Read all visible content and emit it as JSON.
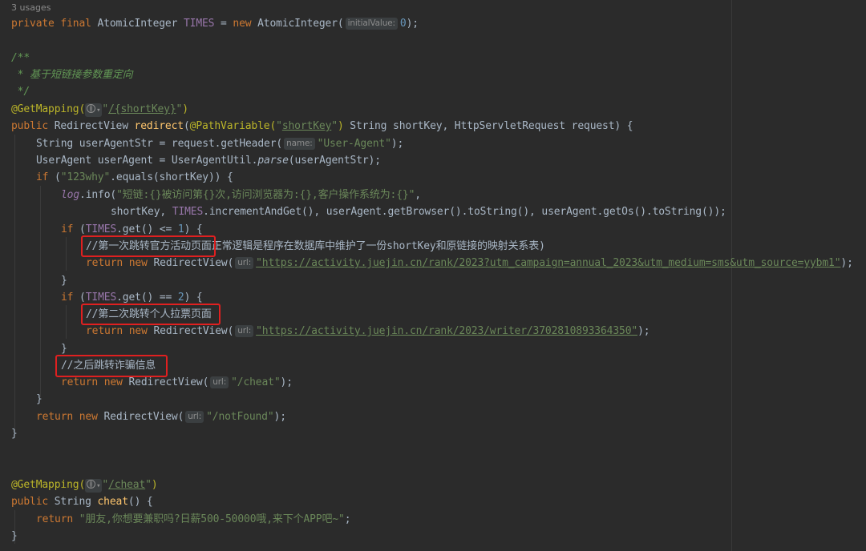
{
  "editor": {
    "usages": "3 usages",
    "colors": {
      "background": "#2b2b2b",
      "keyword": "#cc7832",
      "string": "#6a8759",
      "comment": "#629755",
      "annotation": "#bbb529",
      "field": "#9876aa",
      "method": "#ffc66d",
      "number": "#6897bb",
      "highlight_box": "#e02020"
    },
    "icons": {
      "mapping_hint": "web-globe-icon"
    },
    "hints": {
      "initial_value": "initialValue:",
      "name": "name:",
      "url": "url:"
    },
    "code": {
      "decl": {
        "kw": "private final ",
        "type": "AtomicInteger ",
        "field": "TIMES",
        "eq": " = ",
        "new_kw": "new ",
        "ctor": "AtomicInteger(",
        "num": "0",
        "end": ");"
      },
      "javadoc": {
        "open": "/**",
        "body": " * 基于短链接参数重定向",
        "close": " */"
      },
      "redirect_annot": {
        "annot": "@GetMapping(",
        "path_q1": "\"",
        "path": "/{shortKey}",
        "path_q2": "\"",
        "close": ")"
      },
      "redirect_sig": {
        "kw": "public ",
        "type": "RedirectView ",
        "method": "redirect",
        "open": "(",
        "annot": "@PathVariable(",
        "q1": "\"",
        "param_str": "shortKey",
        "q2": "\"",
        "annot_close": ")",
        "rest": " String shortKey, HttpServletRequest request) {"
      },
      "ua_str": {
        "pre": "String userAgentStr = request.getHeader(",
        "str": "\"User-Agent\"",
        "end": ");"
      },
      "ua_obj": {
        "pre": "UserAgent userAgent = UserAgentUtil.",
        "method": "parse",
        "end": "(userAgentStr);"
      },
      "if_key": {
        "kw": "if ",
        "open": "(",
        "str": "\"123why\"",
        "rest": ".equals(shortKey)) {"
      },
      "log_line": {
        "log": "log",
        "info": ".info(",
        "str": "\"短链:{}被访问第{}次,访问浏览器为:{},客户操作系统为:{}\"",
        "end": ","
      },
      "log_args": {
        "pre": "shortKey, ",
        "field": "TIMES",
        "rest": ".incrementAndGet(), userAgent.getBrowser().toString(), userAgent.getOs().toString());"
      },
      "if1": {
        "kw": "if ",
        "open": "(",
        "field": "TIMES",
        "mid": ".get() <= ",
        "num": "1",
        "end": ") {"
      },
      "comment1": {
        "boxed": "//第一次跳转官方活动页面",
        "rest": "正常逻辑是程序在数据库中维护了一份shortKey和原链接的映射关系表)"
      },
      "ret1": {
        "kw": "return ",
        "new_kw": "new ",
        "ctor": "RedirectView(",
        "url": "\"https://activity.juejin.cn/rank/2023?utm_campaign=annual_2023&utm_medium=sms&utm_source=yybm1\"",
        "end": ");"
      },
      "close_brace": "}",
      "if2": {
        "kw": "if ",
        "open": "(",
        "field": "TIMES",
        "mid": ".get() == ",
        "num": "2",
        "end": ") {"
      },
      "comment2": "//第二次跳转个人拉票页面",
      "ret2": {
        "kw": "return ",
        "new_kw": "new ",
        "ctor": "RedirectView(",
        "url": "\"https://activity.juejin.cn/rank/2023/writer/3702810893364350\"",
        "end": ");"
      },
      "comment3": "//之后跳转诈骗信息",
      "ret3": {
        "kw": "return ",
        "new_kw": "new ",
        "ctor": "RedirectView(",
        "str": "\"/cheat\"",
        "end": ");"
      },
      "ret4": {
        "kw": "return ",
        "new_kw": "new ",
        "ctor": "RedirectView(",
        "str": "\"/notFound\"",
        "end": ");"
      },
      "cheat_annot": {
        "annot": "@GetMapping(",
        "path_q1": "\"",
        "path": "/cheat",
        "path_q2": "\"",
        "close": ")"
      },
      "cheat_sig": {
        "kw": "public ",
        "type": "String ",
        "method": "cheat",
        "rest": "() {"
      },
      "cheat_ret": {
        "kw": "return ",
        "str": "\"朋友,你想要兼职吗?日薪500-50000哦,来下个APP吧~\"",
        "end": ";"
      }
    }
  }
}
